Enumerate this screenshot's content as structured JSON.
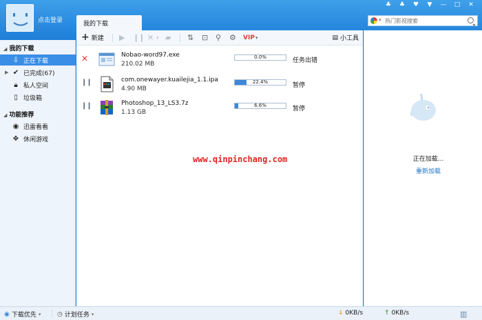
{
  "header": {
    "login_text": "点击登录"
  },
  "tab": {
    "label": "我的下载"
  },
  "search": {
    "placeholder": "热门影视搜索"
  },
  "toolbar": {
    "new_label": "新建",
    "tools_label": "小工具"
  },
  "sidebar": {
    "section1": "我的下载",
    "items": [
      {
        "label": "正在下载",
        "icon": "download-arrow-icon"
      },
      {
        "label": "已完成(67)",
        "icon": "check-icon"
      },
      {
        "label": "私人空间",
        "icon": "lock-icon"
      },
      {
        "label": "垃圾箱",
        "icon": "trash-icon"
      }
    ],
    "section2": "功能推荐",
    "items2": [
      {
        "label": "迅雷看看",
        "icon": "video-icon"
      },
      {
        "label": "休闲游戏",
        "icon": "gamepad-icon"
      }
    ]
  },
  "downloads": [
    {
      "name": "Nobao-word97.exe",
      "size": "210.02 MB",
      "percent": "0.0%",
      "progress": 0.0,
      "status": "任务出错",
      "control": "error-x-icon"
    },
    {
      "name": "com.onewayer.kuailejia_1.1.ipa",
      "size": "4.90 MB",
      "percent": "22.4%",
      "progress": 0.224,
      "status": "暂停",
      "control": "pause-icon"
    },
    {
      "name": "Photoshop_13_LS3.7z",
      "size": "1.13 GB",
      "percent": "6.6%",
      "progress": 0.066,
      "status": "暂停",
      "control": "pause-icon"
    }
  ],
  "watermark": "www.qinpinchang.com",
  "right_panel": {
    "loading": "正在加载...",
    "reload": "重新加载"
  },
  "statusbar": {
    "priority": "下载优先",
    "schedule": "计划任务",
    "down_speed": "0KB/s",
    "up_speed": "0KB/s"
  },
  "colors": {
    "accent": "#2a8be0",
    "active_item": "#3a8ee6",
    "progress": "#3e87d6",
    "error": "#e53935",
    "watermark": "#e0241f"
  }
}
